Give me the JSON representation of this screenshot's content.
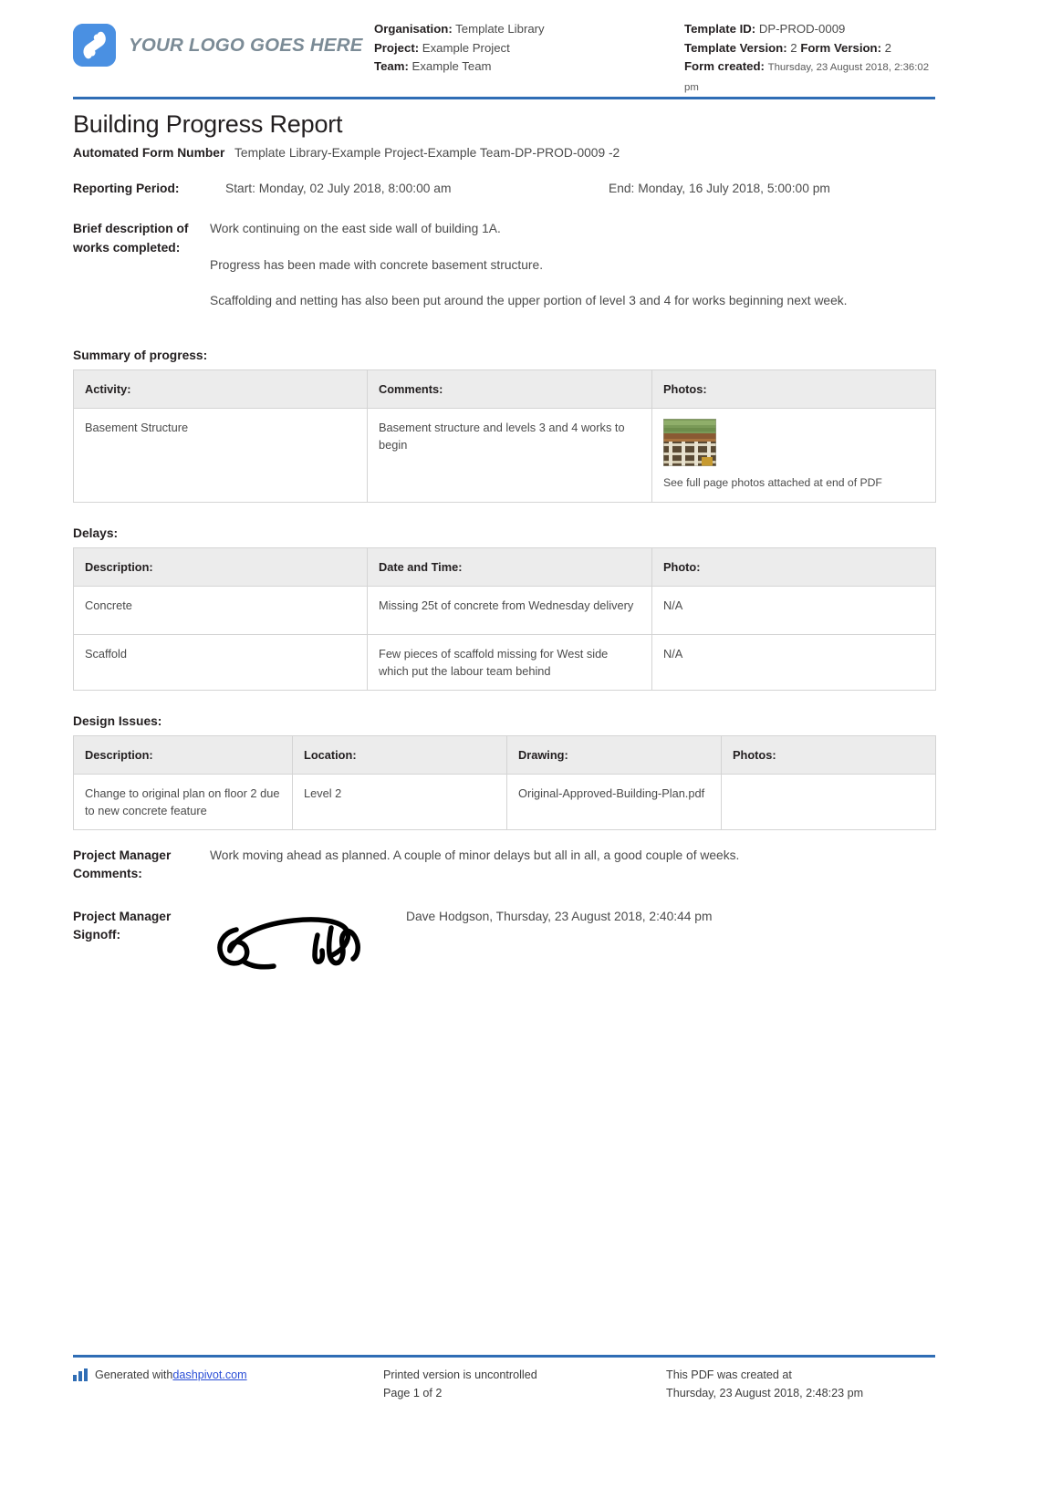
{
  "header": {
    "logo_text": "YOUR LOGO GOES HERE",
    "organisation_label": "Organisation:",
    "organisation_value": "Template Library",
    "project_label": "Project:",
    "project_value": "Example Project",
    "team_label": "Team:",
    "team_value": "Example Team",
    "template_id_label": "Template ID:",
    "template_id_value": "DP-PROD-0009",
    "template_version_label": "Template Version:",
    "template_version_value": "2",
    "form_version_label": "Form Version:",
    "form_version_value": "2",
    "form_created_label": "Form created:",
    "form_created_value": "Thursday, 23 August 2018, 2:36:02 pm"
  },
  "title": "Building Progress Report",
  "fields": {
    "form_number_label": "Automated Form Number",
    "form_number_value": "Template Library-Example Project-Example Team-DP-PROD-0009   -2",
    "reporting_period_label": "Reporting Period:",
    "reporting_period_start": "Start: Monday, 02 July 2018, 8:00:00 am",
    "reporting_period_end": "End: Monday, 16 July 2018, 5:00:00 pm",
    "description_label": "Brief description of works completed:",
    "description_paragraphs": [
      "Work continuing on the east side wall of building 1A.",
      "Progress has been made with concrete basement structure.",
      "Scaffolding and netting has also been put around the upper portion of level 3 and 4 for works beginning next week."
    ]
  },
  "summary_of_progress": {
    "heading": "Summary of progress:",
    "columns": [
      "Activity:",
      "Comments:",
      "Photos:"
    ],
    "rows": [
      {
        "activity": "Basement Structure",
        "comments": "Basement structure and levels 3 and 4 works to begin",
        "photo_caption": "See full page photos attached at end of PDF",
        "photo_alt": "construction-site-photo"
      }
    ]
  },
  "delays": {
    "heading": "Delays:",
    "columns": [
      "Description:",
      "Date and Time:",
      "Photo:"
    ],
    "rows": [
      {
        "description": "Concrete",
        "date_and_time": "Missing 25t of concrete from Wednesday delivery",
        "photo": "N/A"
      },
      {
        "description": "Scaffold",
        "date_and_time": "Few pieces of scaffold missing for West side which put the labour team behind",
        "photo": "N/A"
      }
    ]
  },
  "design_issues": {
    "heading": "Design Issues:",
    "columns": [
      "Description:",
      "Location:",
      "Drawing:",
      "Photos:"
    ],
    "rows": [
      {
        "description": "Change to original plan on floor 2 due to new concrete feature",
        "location": "Level 2",
        "drawing": "Original-Approved-Building-Plan.pdf",
        "photos": ""
      }
    ]
  },
  "project_manager_comments": {
    "label": "Project Manager Comments:",
    "value": "Work moving ahead as planned. A couple of minor delays but all in all, a good couple of weeks."
  },
  "project_manager_signoff": {
    "label": "Project Manager Signoff:",
    "signer": "Dave Hodgson, Thursday, 23 August 2018, 2:40:44 pm"
  },
  "footer": {
    "generated_prefix": "Generated with ",
    "generated_link": "dashpivot.com",
    "uncontrolled": "Printed version is uncontrolled",
    "page_number": "Page 1 of 2",
    "created_at_label": "This PDF was created at",
    "created_at_value": "Thursday, 23 August 2018, 2:48:23 pm"
  },
  "colors": {
    "brand_blue": "#4a90e2",
    "rule_blue": "#2f6db5",
    "link_blue": "#2a4ed6",
    "table_header_bg": "#ececec"
  }
}
